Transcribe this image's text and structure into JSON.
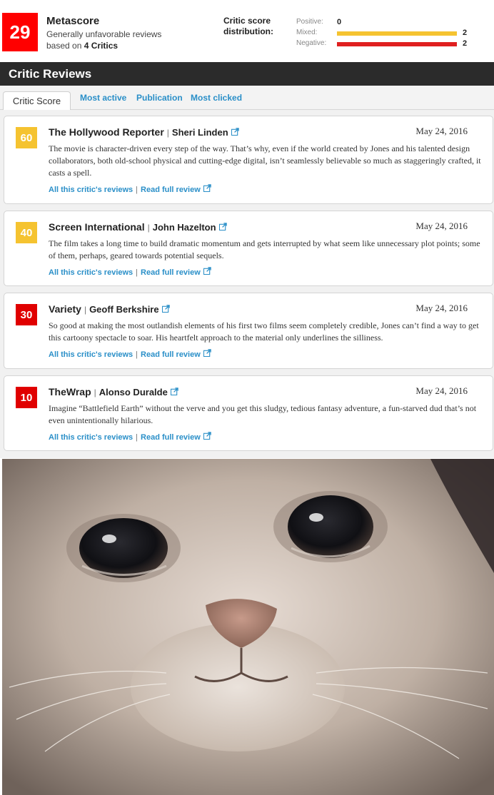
{
  "metascore": {
    "value": "29",
    "color": "#ff0000",
    "title": "Metascore",
    "summary_line1": "Generally unfavorable reviews",
    "summary_line2_prefix": "based on ",
    "summary_line2_count": "4 Critics"
  },
  "distribution": {
    "title": "Critic score distribution:",
    "rows": [
      {
        "label": "Positive:",
        "count": "0",
        "fraction": 0,
        "color": "#6c3"
      },
      {
        "label": "Mixed:",
        "count": "2",
        "fraction": 1,
        "color": "#f5c330"
      },
      {
        "label": "Negative:",
        "count": "2",
        "fraction": 1,
        "color": "#e02020"
      }
    ]
  },
  "section_title": "Critic Reviews",
  "tabs": {
    "active": "Critic Score",
    "links": [
      "Most active",
      "Publication",
      "Most clicked"
    ]
  },
  "reviews": [
    {
      "score": "60",
      "score_color": "#f5c330",
      "publication": "The Hollywood Reporter",
      "critic": "Sheri Linden",
      "date": "May 24, 2016",
      "text": "The movie is character-driven every step of the way. That’s why, even if the world created by Jones and his talented design collaborators, both old-school physical and cutting-edge digital, isn’t seamlessly believable so much as staggeringly crafted, it casts a spell.",
      "link_all": "All this critic's reviews",
      "link_full": "Read full review"
    },
    {
      "score": "40",
      "score_color": "#f5c330",
      "publication": "Screen International",
      "critic": "John Hazelton",
      "date": "May 24, 2016",
      "text": "The film takes a long time to build dramatic momentum and gets interrupted by what seem like unnecessary plot points; some of them, perhaps, geared towards potential sequels.",
      "link_all": "All this critic's reviews",
      "link_full": "Read full review"
    },
    {
      "score": "30",
      "score_color": "#e00000",
      "publication": "Variety",
      "critic": "Geoff Berkshire",
      "date": "May 24, 2016",
      "text": "So good at making the most outlandish elements of his first two films seem completely credible, Jones can’t find a way to get this cartoony spectacle to soar. His heartfelt approach to the material only underlines the silliness.",
      "link_all": "All this critic's reviews",
      "link_full": "Read full review"
    },
    {
      "score": "10",
      "score_color": "#e00000",
      "publication": "TheWrap",
      "critic": "Alonso Duralde",
      "date": "May 24, 2016",
      "text": "Imagine “Battlefield Earth” without the verve and you get this sludgy, tedious fantasy adventure, a fun-starved dud that’s not even unintentionally hilarious.",
      "link_all": "All this critic's reviews",
      "link_full": "Read full review"
    }
  ],
  "icons": {
    "external_link": "external-link-icon"
  },
  "colors": {
    "link": "#2a8fc8",
    "header_bar": "#2b2b2b"
  }
}
